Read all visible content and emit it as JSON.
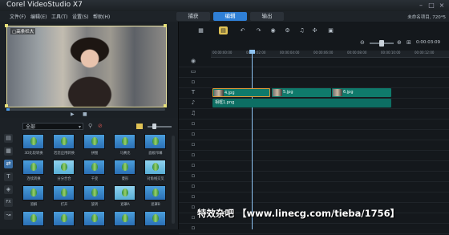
{
  "app": {
    "title": "Corel VideoStudio X7"
  },
  "window": {
    "minimize_icon": "minimize-icon",
    "maximize_icon": "maximize-icon",
    "close_icon": "close-icon"
  },
  "menu": [
    "文件(F)",
    "编辑(E)",
    "工具(T)",
    "设置(S)",
    "帮助(H)"
  ],
  "steps": [
    {
      "label": "捕获",
      "active": false
    },
    {
      "label": "编辑",
      "active": true
    },
    {
      "label": "输出",
      "active": false
    }
  ],
  "project_info": "未命名项目, 720*5",
  "preview": {
    "label": "▢高条栏大",
    "progress": 0.02
  },
  "library": {
    "category": "全部",
    "sidebar": [
      "media-icon",
      "instant-project-icon",
      "transition-icon",
      "title-icon",
      "graphic-icon",
      "filter-icon",
      "path-icon"
    ],
    "thumbnails": [
      {
        "label": "3D比较转换"
      },
      {
        "label": "若您应用转换"
      },
      {
        "label": "拼图"
      },
      {
        "label": "马赛克"
      },
      {
        "label": "面板帘幕"
      },
      {
        "label": "连续转换"
      },
      {
        "label": "分分合合"
      },
      {
        "label": "千变"
      },
      {
        "label": "菱形"
      },
      {
        "label": "对角线交叉"
      },
      {
        "label": "溶解"
      },
      {
        "label": "打开"
      },
      {
        "label": "旋转"
      },
      {
        "label": "遮罩A"
      },
      {
        "label": "遮罩B"
      },
      {
        "label": ""
      },
      {
        "label": ""
      },
      {
        "label": ""
      },
      {
        "label": ""
      },
      {
        "label": ""
      }
    ]
  },
  "timeline": {
    "ruler_labels": [
      "00:00:00:00",
      "00:00:02:00",
      "00:00:04:00",
      "00:00:06:00",
      "00:00:08:00",
      "00:00:10:00",
      "00:00:12:00"
    ],
    "timecode": "0:00:03:09",
    "clips": [
      {
        "label": "4.jpg",
        "kind": "video"
      },
      {
        "label": "5.jpg",
        "kind": "video"
      },
      {
        "label": "6.jpg",
        "kind": "video"
      },
      {
        "label": "相框1.png",
        "kind": "title"
      }
    ]
  },
  "watermark": "特效杂吧 【www.linecg.com/tieba/1756】"
}
